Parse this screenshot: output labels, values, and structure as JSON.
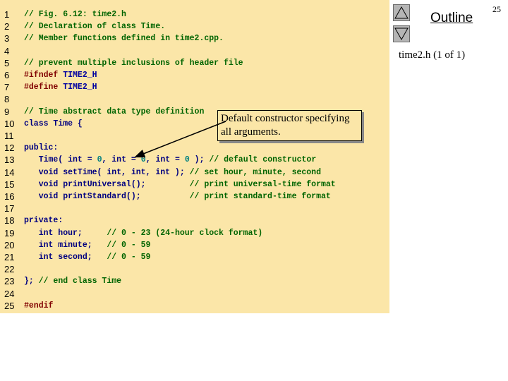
{
  "slide": {
    "page_number": "25",
    "outline_title": "Outline",
    "outline_subtitle": "time2.h (1 of 1)",
    "callout_text": "Default constructor specifying all arguments."
  },
  "code": {
    "lines": [
      {
        "num": "1",
        "segments": [
          {
            "t": "// Fig. 6.12: time2.h",
            "c": "cm"
          }
        ]
      },
      {
        "num": "2",
        "segments": [
          {
            "t": "// Declaration of class Time.",
            "c": "cm"
          }
        ]
      },
      {
        "num": "3",
        "segments": [
          {
            "t": "// Member functions defined in time2.cpp.",
            "c": "cm"
          }
        ]
      },
      {
        "num": "4",
        "segments": []
      },
      {
        "num": "5",
        "segments": [
          {
            "t": "// prevent multiple inclusions of header file",
            "c": "cm"
          }
        ]
      },
      {
        "num": "6",
        "segments": [
          {
            "t": "#ifndef ",
            "c": "pp"
          },
          {
            "t": "TIME2_H",
            "c": "mac"
          }
        ]
      },
      {
        "num": "7",
        "segments": [
          {
            "t": "#define ",
            "c": "pp"
          },
          {
            "t": "TIME2_H",
            "c": "mac"
          }
        ]
      },
      {
        "num": "8",
        "segments": []
      },
      {
        "num": "9",
        "segments": [
          {
            "t": "// Time abstract data type definition",
            "c": "cm"
          }
        ]
      },
      {
        "num": "10",
        "segments": [
          {
            "t": "class ",
            "c": "kw"
          },
          {
            "t": "Time {",
            "c": "kw"
          }
        ]
      },
      {
        "num": "11",
        "segments": []
      },
      {
        "num": "12",
        "segments": [
          {
            "t": "public",
            "c": "kw"
          },
          {
            "t": ":",
            "c": "kw"
          }
        ]
      },
      {
        "num": "13",
        "segments": [
          {
            "t": "   Time( ",
            "c": "kw"
          },
          {
            "t": "int",
            "c": "kw"
          },
          {
            "t": " = ",
            "c": "kw"
          },
          {
            "t": "0",
            "c": "num"
          },
          {
            "t": ", ",
            "c": "kw"
          },
          {
            "t": "int",
            "c": "kw"
          },
          {
            "t": " = ",
            "c": "kw"
          },
          {
            "t": "0",
            "c": "num"
          },
          {
            "t": ", ",
            "c": "kw"
          },
          {
            "t": "int",
            "c": "kw"
          },
          {
            "t": " = ",
            "c": "kw"
          },
          {
            "t": "0",
            "c": "num"
          },
          {
            "t": " ); ",
            "c": "kw"
          },
          {
            "t": "// default constructor",
            "c": "cm"
          }
        ]
      },
      {
        "num": "14",
        "segments": [
          {
            "t": "   void setTime( int, int, int ); ",
            "c": "kw"
          },
          {
            "t": "// set hour, minute, second",
            "c": "cm"
          }
        ]
      },
      {
        "num": "15",
        "segments": [
          {
            "t": "   void printUniversal();         ",
            "c": "kw"
          },
          {
            "t": "// print universal-time format",
            "c": "cm"
          }
        ]
      },
      {
        "num": "16",
        "segments": [
          {
            "t": "   void printStandard();          ",
            "c": "kw"
          },
          {
            "t": "// print standard-time format",
            "c": "cm"
          }
        ]
      },
      {
        "num": "17",
        "segments": []
      },
      {
        "num": "18",
        "segments": [
          {
            "t": "private",
            "c": "kw"
          },
          {
            "t": ":",
            "c": "kw"
          }
        ]
      },
      {
        "num": "19",
        "segments": [
          {
            "t": "   int hour;     ",
            "c": "kw"
          },
          {
            "t": "// 0 - 23 (24-hour clock format)",
            "c": "cm"
          }
        ]
      },
      {
        "num": "20",
        "segments": [
          {
            "t": "   int minute;   ",
            "c": "kw"
          },
          {
            "t": "// 0 - 59",
            "c": "cm"
          }
        ]
      },
      {
        "num": "21",
        "segments": [
          {
            "t": "   int second;   ",
            "c": "kw"
          },
          {
            "t": "// 0 - 59",
            "c": "cm"
          }
        ]
      },
      {
        "num": "22",
        "segments": []
      },
      {
        "num": "23",
        "segments": [
          {
            "t": "}; ",
            "c": "kw"
          },
          {
            "t": "// end class Time",
            "c": "cm"
          }
        ]
      },
      {
        "num": "24",
        "segments": []
      },
      {
        "num": "25",
        "segments": [
          {
            "t": "#endif",
            "c": "pp"
          }
        ]
      }
    ]
  },
  "nav": {
    "up_icon": "triangle-up-icon",
    "down_icon": "triangle-down-icon"
  },
  "colors": {
    "panel_bg": "#fbe6a8",
    "code_comment": "#006400",
    "code_keyword": "#000080",
    "code_number": "#008080",
    "preprocessor": "#800000"
  }
}
